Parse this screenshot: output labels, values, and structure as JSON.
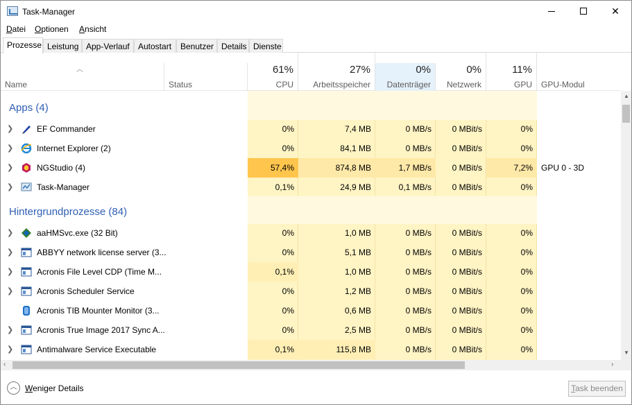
{
  "window": {
    "title": "Task-Manager"
  },
  "menu": [
    {
      "ul": "D",
      "rest": "atei"
    },
    {
      "ul": "O",
      "rest": "ptionen"
    },
    {
      "ul": "A",
      "rest": "nsicht"
    }
  ],
  "tabs": [
    "Prozesse",
    "Leistung",
    "App-Verlauf",
    "Autostart",
    "Benutzer",
    "Details",
    "Dienste"
  ],
  "active_tab": "Prozesse",
  "columns": {
    "name": "Name",
    "status": "Status",
    "cpu": {
      "pct": "61%",
      "label": "CPU"
    },
    "mem": {
      "pct": "27%",
      "label": "Arbeitsspeicher"
    },
    "disk": {
      "pct": "0%",
      "label": "Datenträger"
    },
    "net": {
      "pct": "0%",
      "label": "Netzwerk"
    },
    "gpu": {
      "pct": "11%",
      "label": "GPU"
    },
    "gpu_engine": "GPU-Modul"
  },
  "groups": {
    "apps": "Apps (4)",
    "background": "Hintergrundprozesse (84)"
  },
  "apps": [
    {
      "name": "EF Commander",
      "icon": "ef-commander-icon",
      "cpu": "0%",
      "mem": "7,4 MB",
      "disk": "0 MB/s",
      "net": "0 MBit/s",
      "gpu": "0%",
      "gpu_engine": ""
    },
    {
      "name": "Internet Explorer (2)",
      "icon": "internet-explorer-icon",
      "cpu": "0%",
      "mem": "84,1 MB",
      "disk": "0 MB/s",
      "net": "0 MBit/s",
      "gpu": "0%",
      "gpu_engine": ""
    },
    {
      "name": "NGStudio (4)",
      "icon": "ngstudio-icon",
      "cpu": "57,4%",
      "mem": "874,8 MB",
      "disk": "1,7 MB/s",
      "net": "0 MBit/s",
      "gpu": "7,2%",
      "gpu_engine": "GPU 0 - 3D"
    },
    {
      "name": "Task-Manager",
      "icon": "task-manager-icon",
      "cpu": "0,1%",
      "mem": "24,9 MB",
      "disk": "0,1 MB/s",
      "net": "0 MBit/s",
      "gpu": "0%",
      "gpu_engine": ""
    }
  ],
  "background": [
    {
      "name": "aaHMSvc.exe (32 Bit)",
      "icon": "service-diamond-icon",
      "cpu": "0%",
      "mem": "1,0 MB",
      "disk": "0 MB/s",
      "net": "0 MBit/s",
      "gpu": "0%"
    },
    {
      "name": "ABBYY network license server (3...",
      "icon": "window-service-icon",
      "cpu": "0%",
      "mem": "5,1 MB",
      "disk": "0 MB/s",
      "net": "0 MBit/s",
      "gpu": "0%"
    },
    {
      "name": "Acronis File Level CDP (Time M...",
      "icon": "window-service-icon",
      "cpu": "0,1%",
      "mem": "1,0 MB",
      "disk": "0 MB/s",
      "net": "0 MBit/s",
      "gpu": "0%"
    },
    {
      "name": "Acronis Scheduler Service",
      "icon": "window-service-icon",
      "cpu": "0%",
      "mem": "1,2 MB",
      "disk": "0 MB/s",
      "net": "0 MBit/s",
      "gpu": "0%"
    },
    {
      "name": "Acronis TIB Mounter Monitor (3...",
      "icon": "acronis-disk-icon",
      "cpu": "0%",
      "mem": "0,6 MB",
      "disk": "0 MB/s",
      "net": "0 MBit/s",
      "gpu": "0%"
    },
    {
      "name": "Acronis True Image 2017 Sync A...",
      "icon": "window-service-icon",
      "cpu": "0%",
      "mem": "2,5 MB",
      "disk": "0 MB/s",
      "net": "0 MBit/s",
      "gpu": "0%"
    },
    {
      "name": "Antimalware Service Executable",
      "icon": "window-service-icon",
      "cpu": "0,1%",
      "mem": "115,8 MB",
      "disk": "0 MB/s",
      "net": "0 MBit/s",
      "gpu": "0%"
    }
  ],
  "footer": {
    "fewer_ul": "W",
    "fewer_rest": "eniger Details",
    "end_ul": "T",
    "end_rest": "ask beenden"
  },
  "colors": {
    "heat_light": "#fff4c4",
    "heat_mid": "#ffe9a8",
    "heat_high": "#ffc54d",
    "heat_group": "#fff9e0",
    "disk_header": "#e5f1fb",
    "group_text": "#2f5fb3"
  }
}
